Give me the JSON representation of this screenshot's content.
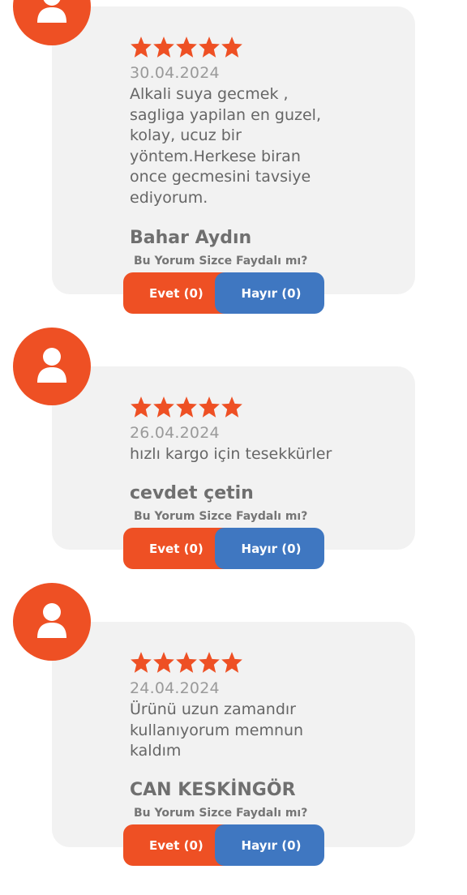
{
  "colors": {
    "accent": "#ee5024",
    "no_button": "#3f77c1",
    "card_bg": "#f2f2f2"
  },
  "reviews": [
    {
      "rating": 5,
      "date": "30.04.2024",
      "text": "Alkali suya gecmek ,\nsagliga yapilan en guzel,\nkolay, ucuz bir\nyöntem.Herkese biran\nonce gecmesini tavsiye\nediyorum.",
      "author": "Bahar Aydın",
      "helpful_question": "Bu Yorum Sizce Faydalı mı?",
      "yes_label": "Evet (0)",
      "no_label": "Hayır (0)"
    },
    {
      "rating": 5,
      "date": "26.04.2024",
      "text": "hızlı kargo için tesekkürler",
      "author": "cevdet çetin",
      "helpful_question": "Bu Yorum Sizce Faydalı mı?",
      "yes_label": "Evet (0)",
      "no_label": "Hayır (0)"
    },
    {
      "rating": 5,
      "date": "24.04.2024",
      "text": "Ürünü uzun zamandır\nkullanıyorum memnun\nkaldım",
      "author": "CAN KESKİNGÖR",
      "helpful_question": "Bu Yorum Sizce Faydalı mı?",
      "yes_label": "Evet (0)",
      "no_label": "Hayır (0)"
    }
  ]
}
